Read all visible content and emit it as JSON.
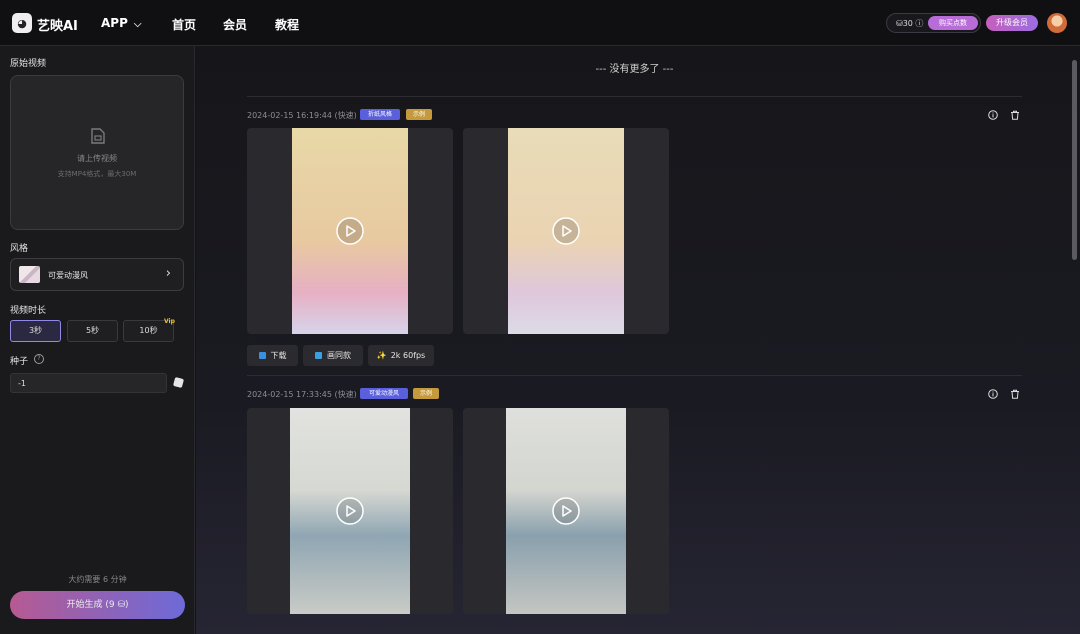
{
  "header": {
    "brand": "艺映AI",
    "nav": [
      "APP",
      "首页",
      "会员",
      "教程"
    ],
    "credits": "30",
    "buy_label": "购买点数",
    "upgrade_label": "升级会员"
  },
  "sidebar": {
    "source_video_label": "原始视频",
    "upload_title": "请上传视频",
    "upload_hint": "支持MP4格式，最大30M",
    "style_label": "风格",
    "style_value": "可爱动漫风",
    "duration_label": "视频时长",
    "durations": [
      "3秒",
      "5秒",
      "10秒"
    ],
    "active_duration": "3秒",
    "vip_badge": "Vip",
    "seed_label": "种子",
    "seed_value": "-1",
    "estimate": "大约需要 6 分钟",
    "generate_label": "开始生成 (9 ⛁)"
  },
  "main": {
    "no_more": "--- 没有更多了 ---",
    "tasks": [
      {
        "time": "2024-02-15 16:19:44 (快速)",
        "style_tag": "折纸风格",
        "sample_tag": "示例",
        "actions": [
          "下载",
          "画同款",
          "2k 60fps"
        ]
      },
      {
        "time": "2024-02-15 17:33:45 (快速)",
        "style_tag": "可爱动漫风",
        "sample_tag": "示例"
      }
    ]
  },
  "colors": {
    "accent": "#6d6ad8",
    "gradient_start": "#b65a92",
    "tag_style": "#5a5fdc",
    "tag_sample": "#c49a3c",
    "vip": "#f3c12b"
  }
}
